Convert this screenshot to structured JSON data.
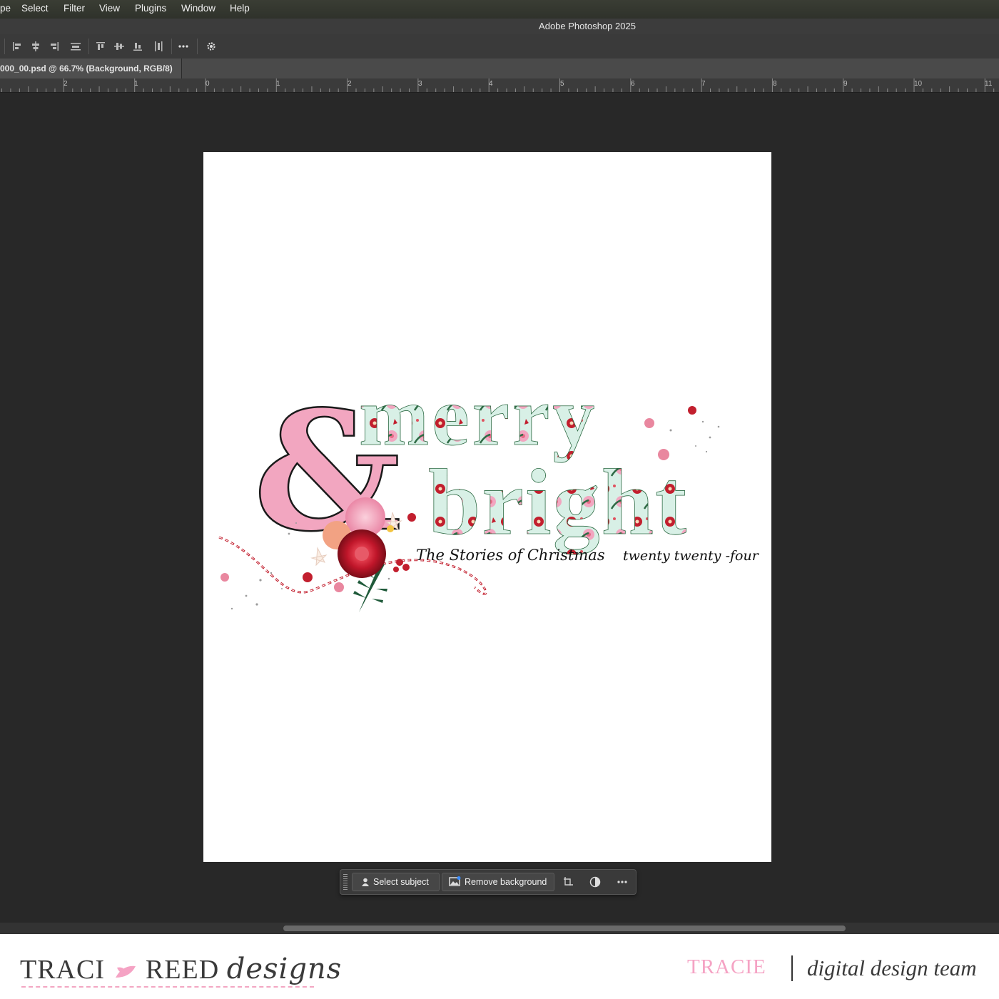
{
  "menu": {
    "items": [
      "pe",
      "Select",
      "Filter",
      "View",
      "Plugins",
      "Window",
      "Help"
    ]
  },
  "app": {
    "title": "Adobe Photoshop 2025"
  },
  "document_tab": {
    "label": "000_00.psd @ 66.7% (Background, RGB/8)"
  },
  "ruler": {
    "labels": [
      "2",
      "1",
      "0",
      "1",
      "2",
      "3",
      "4",
      "5",
      "6",
      "7",
      "8",
      "9",
      "10",
      "11"
    ]
  },
  "artwork": {
    "ampersand": "&",
    "word1": "merry",
    "word2": "bright",
    "subtitle": "The Stories of Christmas",
    "year": "twenty twenty -four"
  },
  "contextual_taskbar": {
    "select_subject": "Select subject",
    "remove_background": "Remove background"
  },
  "footer": {
    "brand_main": "TRACI",
    "brand_second": "REED",
    "brand_script": "designs",
    "name": "TRACIE",
    "team": "digital design team"
  },
  "colors": {
    "pink": "#f2a6c0",
    "mint": "#d8f0e6",
    "red": "#c21f2e",
    "green": "#2f6b45"
  },
  "icons": [
    "align-left-icon",
    "align-center-icon",
    "align-right-icon",
    "distribute-icon",
    "align-top-icon",
    "align-middle-icon",
    "align-bottom-icon",
    "distribute-vertical-icon",
    "more-icon",
    "gear-icon",
    "person-icon",
    "image-icon",
    "crop-icon",
    "adjust-icon",
    "more-icon"
  ]
}
